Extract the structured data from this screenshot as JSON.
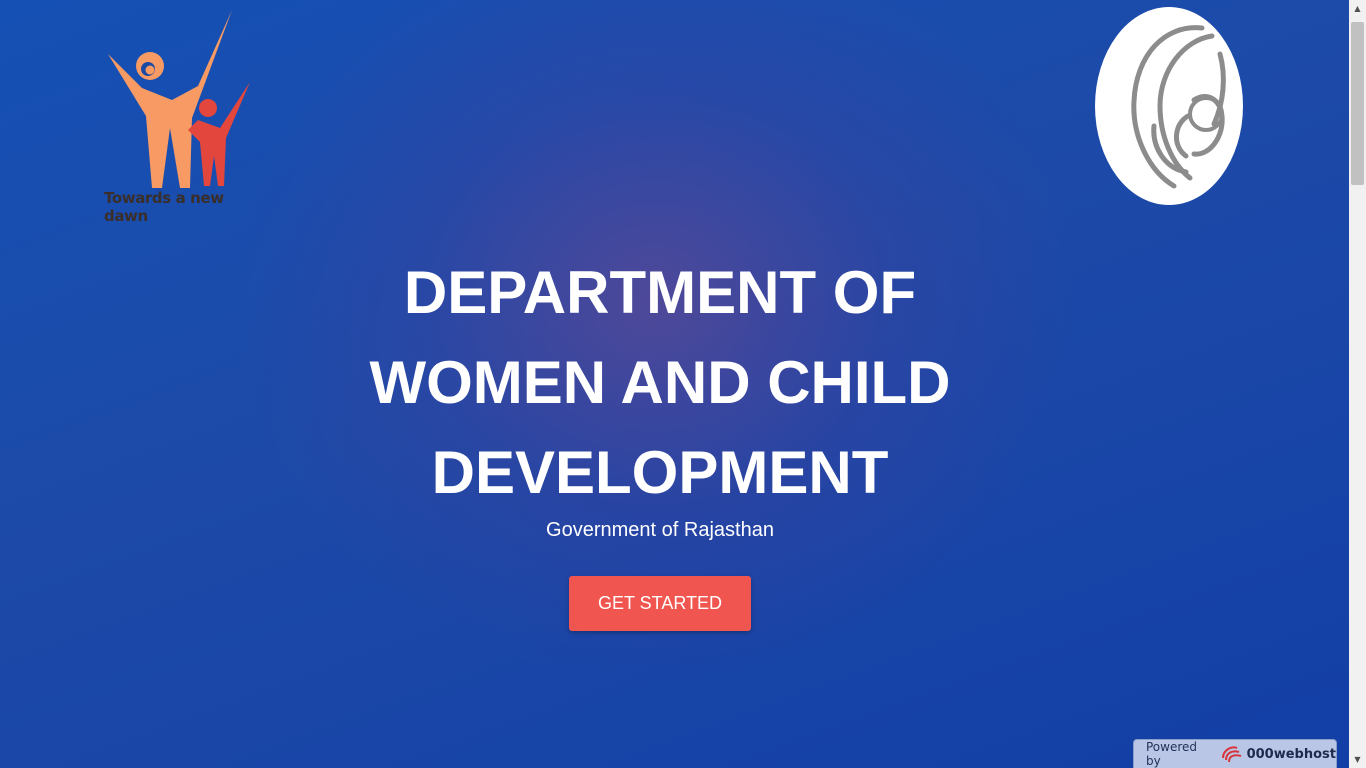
{
  "header": {
    "left_logo": {
      "icon": "family-logo-icon",
      "tagline": "Towards a new dawn",
      "colors": {
        "adult": "#f79a63",
        "child": "#e2463c"
      }
    },
    "right_logo": {
      "icon": "mother-child-logo-icon"
    }
  },
  "hero": {
    "title_lines": [
      "DEPARTMENT OF",
      "WOMEN AND CHILD",
      "DEVELOPMENT"
    ],
    "subtitle": "Government of Rajasthan",
    "cta_label": "GET STARTED"
  },
  "footer_badge": {
    "label": "Powered by",
    "brand": "000webhost",
    "icon": "000webhost-logo-icon"
  },
  "colors": {
    "background": "#1446a8",
    "cta": "#f0564f",
    "text": "#ffffff"
  }
}
